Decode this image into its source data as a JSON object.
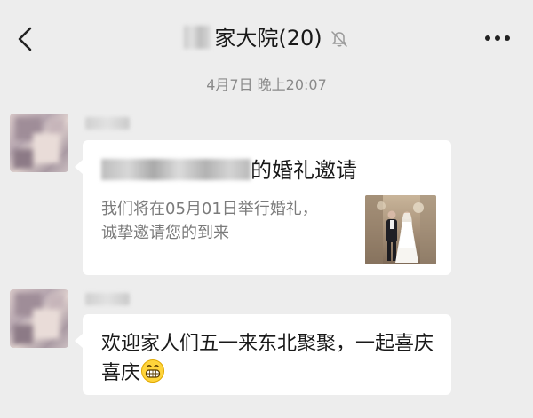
{
  "header": {
    "title": "家大院(20)",
    "back_icon": "chevron-left-icon",
    "mute_icon": "bell-muted-icon",
    "more_icon": "more-dots-icon"
  },
  "timestamp": "4月7日 晚上20:07",
  "messages": [
    {
      "type": "card",
      "title_suffix": "的婚礼邀请",
      "description": "我们将在05月01日举行婚礼，诚挚邀请您的到来",
      "thumbnail": "wedding-photo"
    },
    {
      "type": "text",
      "text": "欢迎家人们五一来东北聚聚，一起喜庆喜庆",
      "emoji": "grinning-face-emoji"
    }
  ],
  "colors": {
    "background": "#ededed",
    "bubble": "#ffffff",
    "text": "#191919",
    "muted_text": "#8a8a8a"
  }
}
